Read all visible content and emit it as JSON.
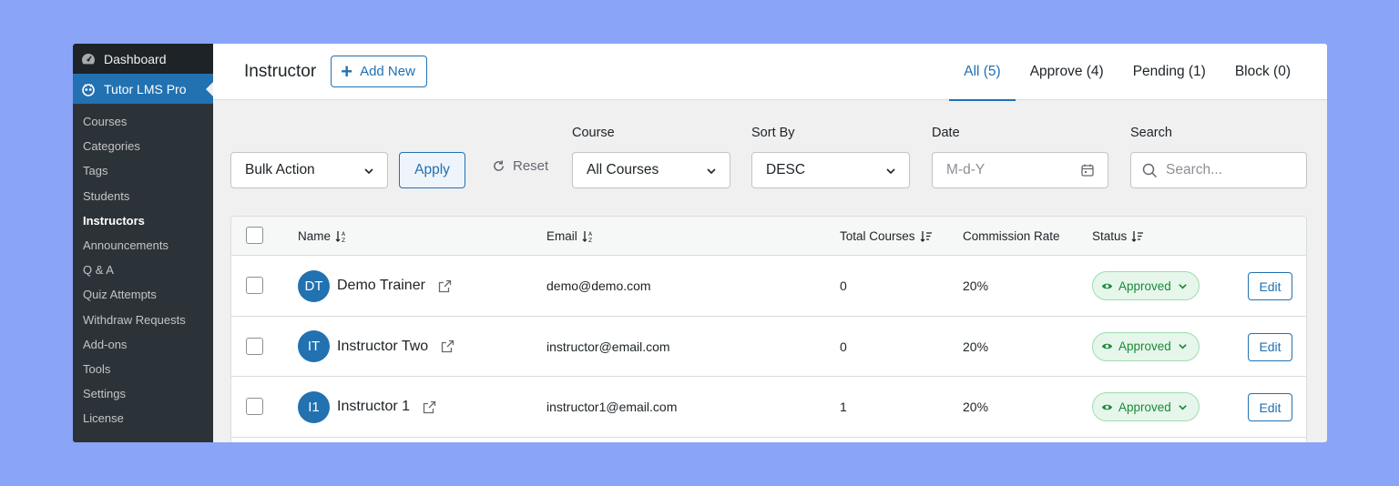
{
  "sidebar": {
    "dashboard_label": "Dashboard",
    "plugin_label": "Tutor LMS Pro",
    "items": [
      {
        "label": "Courses"
      },
      {
        "label": "Categories"
      },
      {
        "label": "Tags"
      },
      {
        "label": "Students"
      },
      {
        "label": "Instructors",
        "current": true
      },
      {
        "label": "Announcements"
      },
      {
        "label": "Q & A"
      },
      {
        "label": "Quiz Attempts"
      },
      {
        "label": "Withdraw Requests"
      },
      {
        "label": "Add-ons"
      },
      {
        "label": "Tools"
      },
      {
        "label": "Settings"
      },
      {
        "label": "License"
      }
    ]
  },
  "header": {
    "title": "Instructor",
    "add_new_label": "Add New",
    "tabs": [
      {
        "label": "All (5)",
        "active": true
      },
      {
        "label": "Approve (4)"
      },
      {
        "label": "Pending (1)"
      },
      {
        "label": "Block (0)"
      }
    ]
  },
  "filters": {
    "bulk_action": "Bulk Action",
    "apply_label": "Apply",
    "reset_label": "Reset",
    "course_label": "Course",
    "course_value": "All Courses",
    "sort_label": "Sort By",
    "sort_value": "DESC",
    "date_label": "Date",
    "date_placeholder": "M-d-Y",
    "search_label": "Search",
    "search_placeholder": "Search..."
  },
  "table": {
    "columns": {
      "name": "Name",
      "email": "Email",
      "total_courses": "Total Courses",
      "commission_rate": "Commission Rate",
      "status": "Status"
    },
    "edit_label": "Edit",
    "rows": [
      {
        "initials": "DT",
        "name": "Demo Trainer",
        "email": "demo@demo.com",
        "courses": "0",
        "commission": "20%",
        "status": "Approved"
      },
      {
        "initials": "IT",
        "name": "Instructor Two",
        "email": "instructor@email.com",
        "courses": "0",
        "commission": "20%",
        "status": "Approved"
      },
      {
        "initials": "I1",
        "name": "Instructor 1",
        "email": "instructor1@email.com",
        "courses": "1",
        "commission": "20%",
        "status": "Approved"
      }
    ]
  },
  "colors": {
    "accent": "#2271b1",
    "sidebar_bg": "#1d2327",
    "approved_green": "#1a8a3a"
  }
}
